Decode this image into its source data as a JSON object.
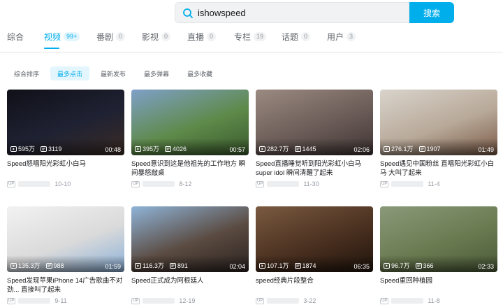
{
  "search": {
    "query": "ishowspeed",
    "button_label": "搜索"
  },
  "tabs": [
    {
      "label": "综合",
      "count": ""
    },
    {
      "label": "视频",
      "count": "99+"
    },
    {
      "label": "番剧",
      "count": "0"
    },
    {
      "label": "影视",
      "count": "0"
    },
    {
      "label": "直播",
      "count": "0"
    },
    {
      "label": "专栏",
      "count": "19"
    },
    {
      "label": "话题",
      "count": "0"
    },
    {
      "label": "用户",
      "count": "3"
    }
  ],
  "sorts": [
    "综合排序",
    "最多点击",
    "最新发布",
    "最多弹幕",
    "最多收藏"
  ],
  "videos": [
    {
      "title": "Speed怒唱阳光彩虹小白马",
      "views": "595万",
      "danmaku": "3119",
      "duration": "00:48",
      "date": "10-10",
      "thumb_colors": [
        "#101018",
        "#1f2233",
        "#3b2b24"
      ]
    },
    {
      "title": "Speed意识到这是他祖先的工作地方 瞬间暴怒敲桌",
      "views": "395万",
      "danmaku": "4026",
      "duration": "00:57",
      "date": "8-12",
      "thumb_colors": [
        "#7fa0c8",
        "#5e8a4a",
        "#3a5a2c"
      ]
    },
    {
      "title": "Speed直播睡觉听到阳光彩虹小白马 super idol 瞬间清醒了起来",
      "views": "282.7万",
      "danmaku": "1445",
      "duration": "02:06",
      "date": "11-30",
      "thumb_colors": [
        "#9a8a80",
        "#6b5c58",
        "#3e3433"
      ]
    },
    {
      "title": "Speed遇见中国粉丝 直唱阳光彩虹小白马 大叫了起来",
      "views": "276.1万",
      "danmaku": "1907",
      "duration": "01:49",
      "date": "11-4",
      "thumb_colors": [
        "#d9d4cc",
        "#b8a999",
        "#7a5a46"
      ]
    },
    {
      "title": "Speed发现苹果iPhone 14广告歌曲不对劲... 直接叫了起来",
      "views": "135.3万",
      "danmaku": "988",
      "duration": "01:59",
      "date": "9-11",
      "thumb_colors": [
        "#f2f2f2",
        "#dadada",
        "#8ab0d8"
      ]
    },
    {
      "title": "Speed正式成为阿根廷人",
      "views": "116.3万",
      "danmaku": "891",
      "duration": "02:04",
      "date": "12-19",
      "thumb_colors": [
        "#8fb4d8",
        "#5a4a40",
        "#2a2220"
      ]
    },
    {
      "title": "speed经典片段整合",
      "views": "107.1万",
      "danmaku": "1874",
      "duration": "06:35",
      "date": "3-22",
      "thumb_colors": [
        "#7a5a40",
        "#4a3020",
        "#20140c"
      ]
    },
    {
      "title": "Speed重回种植园",
      "views": "96.7万",
      "danmaku": "366",
      "duration": "02:33",
      "date": "11-8",
      "thumb_colors": [
        "#8a9a7a",
        "#6a7a50",
        "#4a5a38"
      ]
    }
  ],
  "icons": {
    "search": "search-icon",
    "play": "play-icon",
    "danmaku": "danmaku-icon"
  },
  "colors": {
    "accent": "#00aeec"
  }
}
